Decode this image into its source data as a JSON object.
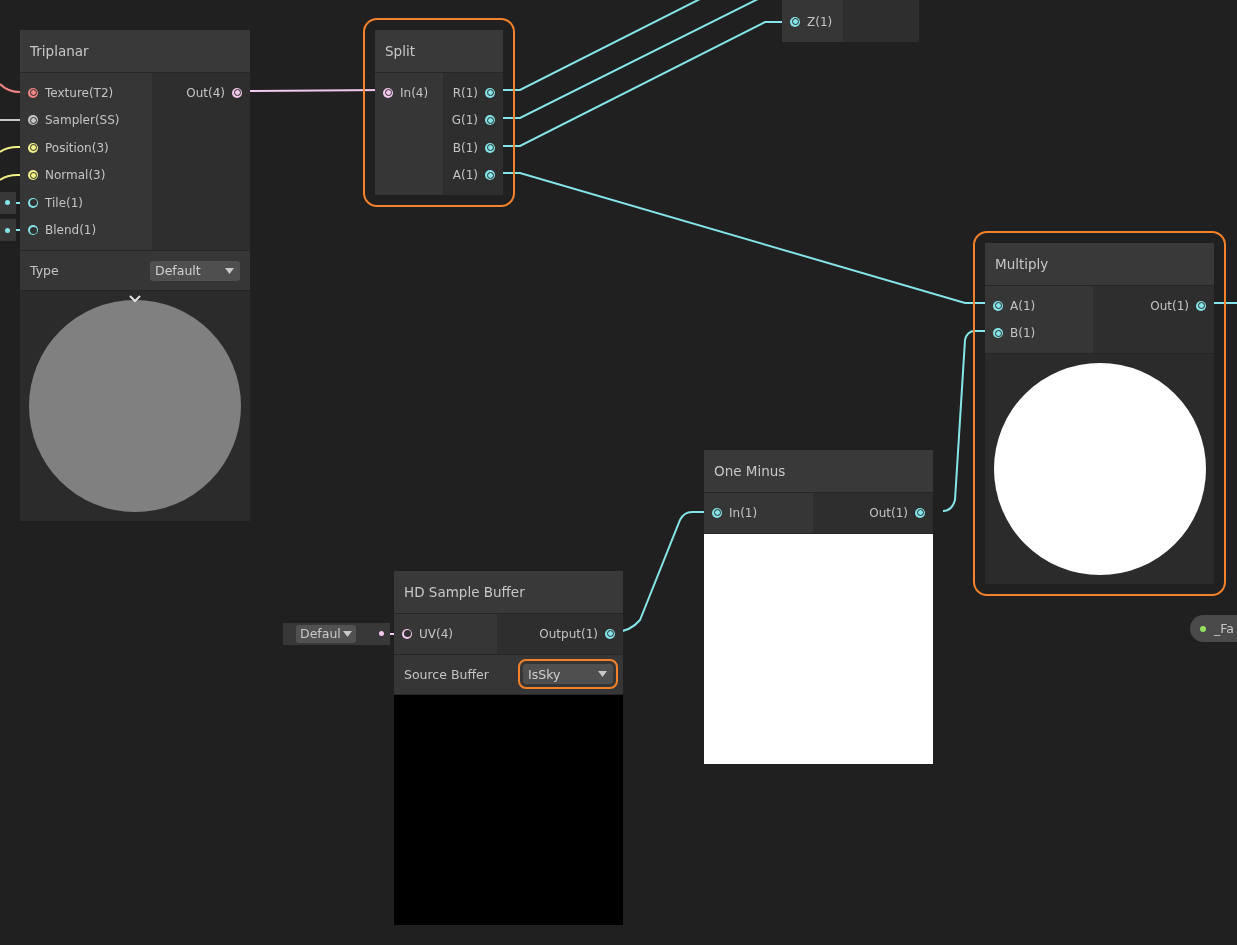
{
  "nodes": [
    {
      "title": "Triplanar",
      "selected": false,
      "inputs": [
        {
          "label": "Texture(T2)",
          "kind": "wired",
          "color": "#f08585"
        },
        {
          "label": "Sampler(SS)",
          "kind": "wired",
          "color": "#c8c8c8"
        },
        {
          "label": "Position(3)",
          "kind": "wired",
          "color": "#f2f28a"
        },
        {
          "label": "Normal(3)",
          "kind": "wired",
          "color": "#f2f28a"
        },
        {
          "label": "Tile(1)",
          "kind": "inline",
          "color": "#84e4e7"
        },
        {
          "label": "Blend(1)",
          "kind": "inline",
          "color": "#84e4e7"
        }
      ],
      "outputs": [
        {
          "label": "Out(4)",
          "color": "#f2c8ee"
        }
      ],
      "setting": {
        "label": "Type",
        "value": "Default",
        "highlighted": false
      },
      "preview": {
        "kind": "sphere",
        "color": "#808080",
        "expander": true
      }
    },
    {
      "title": "Split",
      "selected": true,
      "inputs": [
        {
          "label": "In(4)",
          "kind": "wired",
          "color": "#f2c8ee"
        }
      ],
      "outputs": [
        {
          "label": "R(1)",
          "color": "#84e4e7"
        },
        {
          "label": "G(1)",
          "color": "#84e4e7"
        },
        {
          "label": "B(1)",
          "color": "#84e4e7"
        },
        {
          "label": "A(1)",
          "color": "#84e4e7"
        }
      ]
    },
    {
      "selected": false,
      "inputs": [
        {
          "label": "Z(1)",
          "kind": "wired",
          "color": "#84e4e7"
        }
      ]
    },
    {
      "title": "Multiply",
      "selected": true,
      "inputs": [
        {
          "label": "A(1)",
          "kind": "wired",
          "color": "#84e4e7"
        },
        {
          "label": "B(1)",
          "kind": "wired",
          "color": "#84e4e7"
        }
      ],
      "outputs": [
        {
          "label": "Out(1)",
          "color": "#84e4e7"
        }
      ],
      "preview": {
        "kind": "sphere",
        "color": "#ffffff"
      }
    },
    {
      "title": "One Minus",
      "selected": false,
      "inputs": [
        {
          "label": "In(1)",
          "kind": "wired",
          "color": "#84e4e7"
        }
      ],
      "outputs": [
        {
          "label": "Out(1)",
          "color": "#84e4e7"
        }
      ],
      "preview": {
        "kind": "square",
        "color": "#ffffff"
      }
    },
    {
      "title": "HD Sample Buffer",
      "selected": false,
      "inputs": [
        {
          "label": "UV(4)",
          "kind": "inline",
          "color": "#f2c8ee",
          "inline_text": "Defaul"
        }
      ],
      "outputs": [
        {
          "label": "Output(1)",
          "color": "#84e4e7"
        }
      ],
      "setting": {
        "label": "Source Buffer",
        "value": "IsSky",
        "highlighted": true
      },
      "preview": {
        "kind": "square",
        "color": "#000000"
      }
    }
  ],
  "property": {
    "label": "_Fa",
    "color": "#94e065"
  }
}
